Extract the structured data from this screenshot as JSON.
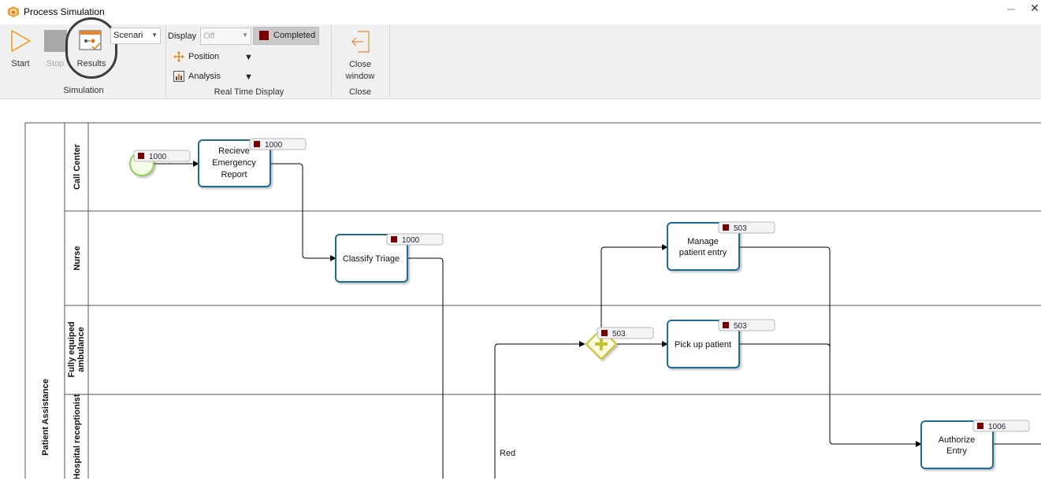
{
  "window": {
    "title": "Process Simulation"
  },
  "ribbon": {
    "simulation": {
      "start_label": "Start",
      "stop_label": "Stop",
      "results_label": "Results",
      "scenario_value": "Scenari",
      "group_label": "Simulation"
    },
    "realtime": {
      "display_label": "Display",
      "display_value": "Off",
      "completed_label": "Completed",
      "position_label": "Position",
      "analysis_label": "Analysis",
      "group_label": "Real Time Display"
    },
    "close": {
      "close_label_line1": "Close",
      "close_label_line2": "window",
      "group_label": "Close"
    }
  },
  "diagram": {
    "pool_label": "Patient Assistance",
    "lanes": {
      "call_center": "Call Center",
      "nurse": "Nurse",
      "ambulance_line1": "Fully equiped",
      "ambulance_line2": "ambulance",
      "receptionist": "Hospital receptionist"
    },
    "tasks": {
      "recieve_line1": "Recieve",
      "recieve_line2": "Emergency",
      "recieve_line3": "Report",
      "classify": "Classify Triage",
      "manage_line1": "Manage",
      "manage_line2": "patient entry",
      "pickup": "Pick up patient",
      "authorize_line1": "Authorize",
      "authorize_line2": "Entry"
    },
    "counters": {
      "start_event": "1000",
      "recieve": "1000",
      "classify": "1000",
      "gateway": "503",
      "manage": "503",
      "pickup": "503",
      "authorize": "1006"
    },
    "flow_labels": {
      "red": "Red"
    },
    "colors": {
      "task_border": "#1f6d96",
      "start_event": "#8fcf5a",
      "gateway": "#c9c22a",
      "counter_marker": "#7a0000"
    }
  }
}
